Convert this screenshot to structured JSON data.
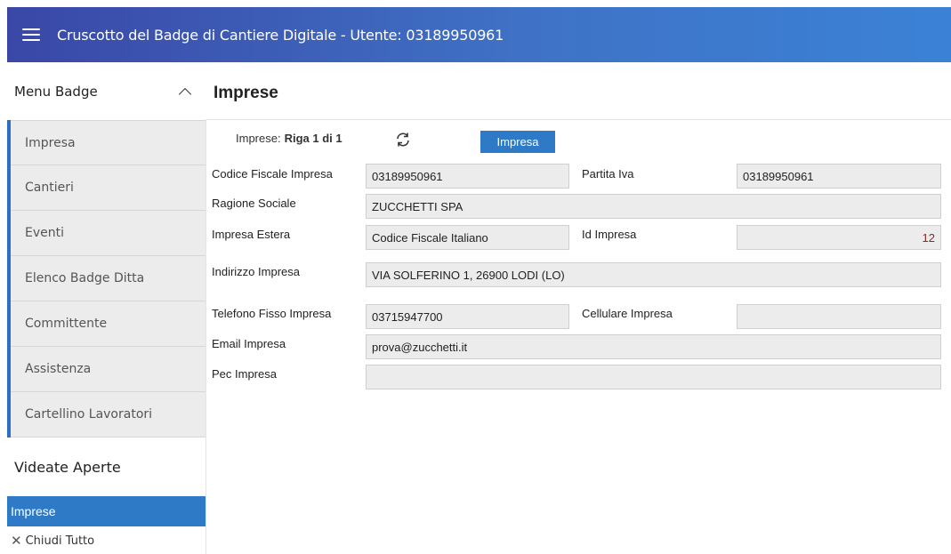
{
  "header": {
    "title": "Cruscotto del Badge di Cantiere Digitale - Utente: 03189950961"
  },
  "sidebar": {
    "menu_title": "Menu Badge",
    "items": [
      {
        "label": "Impresa"
      },
      {
        "label": "Cantieri"
      },
      {
        "label": "Eventi"
      },
      {
        "label": "Elenco Badge Ditta"
      },
      {
        "label": "Committente"
      },
      {
        "label": "Assistenza"
      },
      {
        "label": "Cartellino Lavoratori"
      }
    ],
    "open_title": "Videate Aperte",
    "open_items": [
      {
        "label": "Imprese"
      }
    ],
    "close_all": "Chiudi Tutto"
  },
  "main": {
    "title": "Imprese",
    "record_prefix": "Imprese:",
    "record_info": "Riga 1 di 1",
    "impresa_button": "Impresa",
    "fields": {
      "codice_fiscale": {
        "label": "Codice Fiscale Impresa",
        "value": "03189950961"
      },
      "partita_iva": {
        "label": "Partita Iva",
        "value": "03189950961"
      },
      "ragione_sociale": {
        "label": "Ragione Sociale",
        "value": "ZUCCHETTI SPA"
      },
      "impresa_estera": {
        "label": "Impresa Estera",
        "value": "Codice Fiscale Italiano"
      },
      "id_impresa": {
        "label": "Id Impresa",
        "value": "12"
      },
      "indirizzo": {
        "label": "Indirizzo Impresa",
        "value": "VIA SOLFERINO 1, 26900 LODI (LO)"
      },
      "telefono": {
        "label": "Telefono Fisso Impresa",
        "value": "03715947700"
      },
      "cellulare": {
        "label": "Cellulare Impresa",
        "value": ""
      },
      "email": {
        "label": "Email Impresa",
        "value": "prova@zucchetti.it"
      },
      "pec": {
        "label": "Pec Impresa",
        "value": ""
      }
    }
  },
  "colors": {
    "accent": "#2f7ac6",
    "header_start": "#3a47a6",
    "header_end": "#3b82d6",
    "field_bg": "#ececec"
  }
}
